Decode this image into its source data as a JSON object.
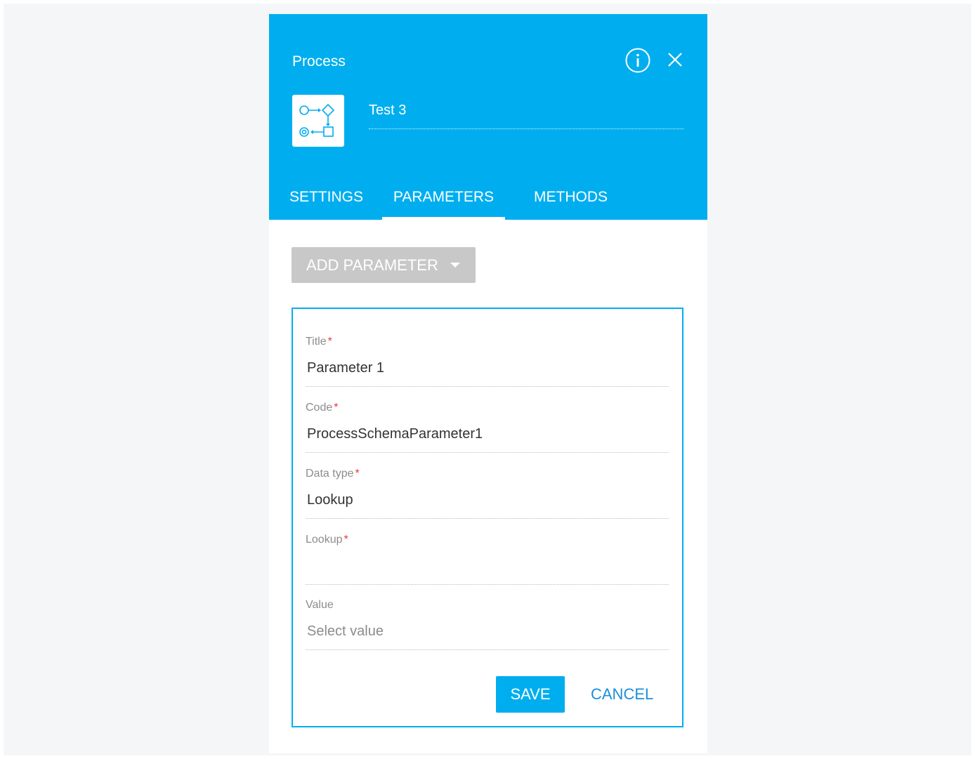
{
  "header": {
    "title": "Process",
    "process_name": "Test 3"
  },
  "tabs": [
    {
      "label": "SETTINGS",
      "active": false
    },
    {
      "label": "PARAMETERS",
      "active": true
    },
    {
      "label": "METHODS",
      "active": false
    }
  ],
  "toolbar": {
    "add_parameter_label": "ADD PARAMETER"
  },
  "form": {
    "fields": [
      {
        "label": "Title",
        "required": "*",
        "value": "Parameter 1"
      },
      {
        "label": "Code",
        "required": "*",
        "value": "ProcessSchemaParameter1"
      },
      {
        "label": "Data type",
        "required": "*",
        "value": "Lookup"
      },
      {
        "label": "Lookup",
        "required": "*",
        "value": ""
      },
      {
        "label": "Value",
        "required": "",
        "value": "",
        "placeholder": "Select value"
      }
    ],
    "save_label": "SAVE",
    "cancel_label": "CANCEL"
  },
  "colors": {
    "accent": "#00aeef",
    "required": "#e53935",
    "link": "#1b8fd8",
    "disabled_button": "#c8c8c8"
  },
  "icons": {
    "info": "info-icon",
    "close": "close-icon",
    "process": "process-diagram-icon",
    "dropdown": "caret-down-icon"
  }
}
